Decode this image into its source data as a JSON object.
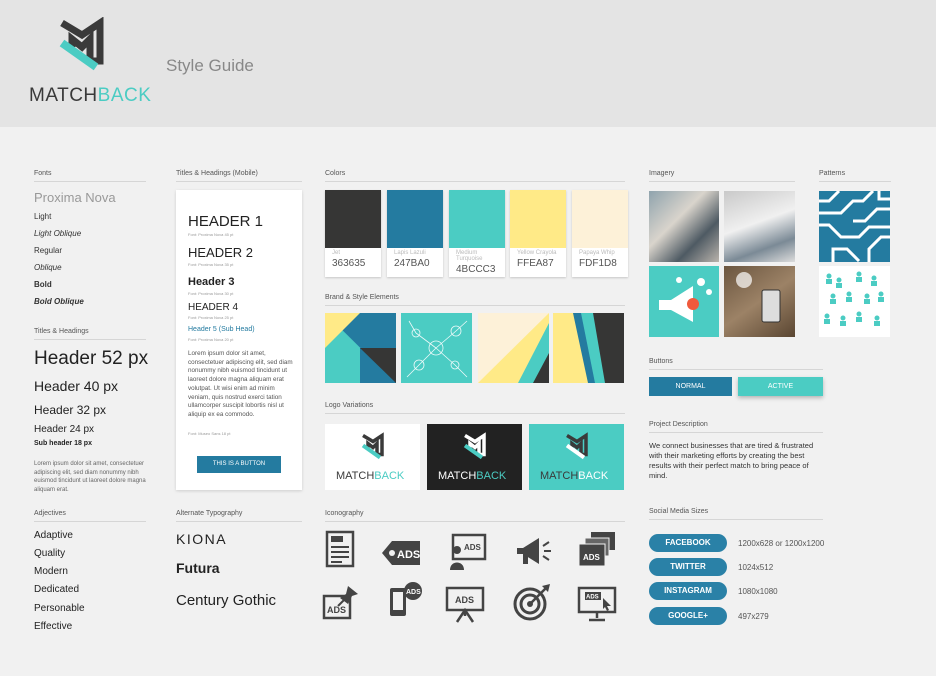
{
  "brand": {
    "name_part1": "MATCH",
    "name_part2": "BACK",
    "page_title": "Style Guide",
    "accent": "#4bccc3",
    "dark": "#363635",
    "blue": "#247ba0"
  },
  "fonts": {
    "title": "Fonts",
    "primary": "Proxima Nova",
    "weights": [
      "Light",
      "Light Oblique",
      "Regular",
      "Oblique",
      "Bold",
      "Bold Oblique"
    ]
  },
  "titles": {
    "title": "Titles & Headings",
    "h52": "Header 52 px",
    "h40": "Header 40 px",
    "h32": "Header 32 px",
    "h24": "Header 24 px",
    "sub18": "Sub header 18 px",
    "body": "Lorem ipsum dolor sit amet, consectetuer adipiscing elit, sed diam nonummy nibh euismod tincidunt ut laoreet dolore magna aliquam erat."
  },
  "adjectives": {
    "title": "Adjectives",
    "items": [
      "Adaptive",
      "Quality",
      "Modern",
      "Dedicated",
      "Personable",
      "Effective"
    ]
  },
  "mobile": {
    "title": "Titles & Headings (Mobile)",
    "h1": "HEADER 1",
    "h1_note": "Font: Proxima Nova 45 pt",
    "h2": "HEADER 2",
    "h2_note": "Font: Proxima Nova 35 pt",
    "h3": "Header 3",
    "h3_note": "Font: Proxima Nova 30 pt",
    "h4": "HEADER 4",
    "h4_note": "Font: Proxima Nova 25 pt",
    "h5": "Header 5 (Sub Head)",
    "h5_note": "Font: Proxima Nova 20 pt",
    "body": "Lorem ipsum dolor sit amet, consectetuer adipiscing elit, sed diam nonummy nibh euismod tincidunt ut laoreet dolore magna aliquam erat volutpat. Ut wisi enim ad minim veniam, quis nostrud exerci tation ullamcorper suscipit lobortis nisl ut aliquip ex ea commodo.",
    "body_note": "Font: Museo Sans 18 pt",
    "button": "THIS IS A BUTTON"
  },
  "alt_typo": {
    "title": "Alternate Typography",
    "items": [
      "KIONA",
      "Futura",
      "Century Gothic"
    ]
  },
  "colors": {
    "title": "Colors",
    "swatches": [
      {
        "name": "Jet",
        "hex": "363635",
        "color": "#363635"
      },
      {
        "name": "Lapis Lazuli",
        "hex": "247BA0",
        "color": "#247ba0"
      },
      {
        "name": "Medium Turquoise",
        "hex": "4BCCC3",
        "color": "#4bccc3"
      },
      {
        "name": "Yellow Crayola",
        "hex": "FFEA87",
        "color": "#ffea87"
      },
      {
        "name": "Papaya Whip",
        "hex": "FDF1D8",
        "color": "#fdf1d8"
      }
    ]
  },
  "brand_elements": {
    "title": "Brand & Style Elements"
  },
  "logo_variations": {
    "title": "Logo Variations"
  },
  "iconography": {
    "title": "Iconography",
    "icons": [
      "ads-document-icon",
      "ads-tag-icon",
      "ads-presenter-icon",
      "megaphone-icon",
      "ads-windows-icon",
      "ads-pin-icon",
      "ads-mobile-icon",
      "ads-easel-icon",
      "target-icon",
      "ads-monitor-icon"
    ],
    "ads_label": "ADS"
  },
  "imagery": {
    "title": "Imagery"
  },
  "patterns": {
    "title": "Patterns"
  },
  "buttons": {
    "title": "Buttons",
    "normal": "NORMAL",
    "active": "ACTIVE"
  },
  "project": {
    "title": "Project Description",
    "text": "We connect businesses that are tired & frustrated with their marketing efforts by creating the best results with their perfect match to bring peace of mind."
  },
  "social": {
    "title": "Social Media Sizes",
    "items": [
      {
        "label": "FACEBOOK",
        "size": "1200x628 or 1200x1200"
      },
      {
        "label": "TWITTER",
        "size": "1024x512"
      },
      {
        "label": "INSTAGRAM",
        "size": "1080x1080"
      },
      {
        "label": "GOOGLE+",
        "size": "497x279"
      }
    ]
  }
}
